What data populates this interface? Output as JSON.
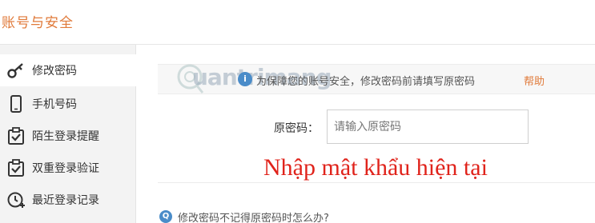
{
  "header": {
    "title": "账号与安全"
  },
  "sidebar": {
    "items": [
      {
        "label": "修改密码",
        "icon": "key-icon",
        "active": true
      },
      {
        "label": "手机号码",
        "icon": "phone-icon",
        "active": false
      },
      {
        "label": "陌生登录提醒",
        "icon": "checkbox-clipboard-icon",
        "active": false
      },
      {
        "label": "双重登录验证",
        "icon": "checkbox-clipboard-icon",
        "active": false
      },
      {
        "label": "最近登录记录",
        "icon": "clock-plus-icon",
        "active": false
      }
    ]
  },
  "notice": {
    "icon": "info-icon",
    "text": "为保障您的账号安全，修改密码前请填写原密码",
    "help_label": "帮助"
  },
  "form": {
    "old_password_label": "原密码：",
    "old_password_placeholder": "请输入原密码",
    "old_password_value": ""
  },
  "annotation": {
    "caption": "Nhập mật khẩu hiện tại"
  },
  "watermark": {
    "text": "uantrimang"
  },
  "faq": {
    "icon": "question-icon",
    "text": "修改密码不记得原密码时怎么办?"
  },
  "colors": {
    "accent": "#e07a3a",
    "caption_red": "#e0231b",
    "info_blue": "#4a8cc9"
  }
}
